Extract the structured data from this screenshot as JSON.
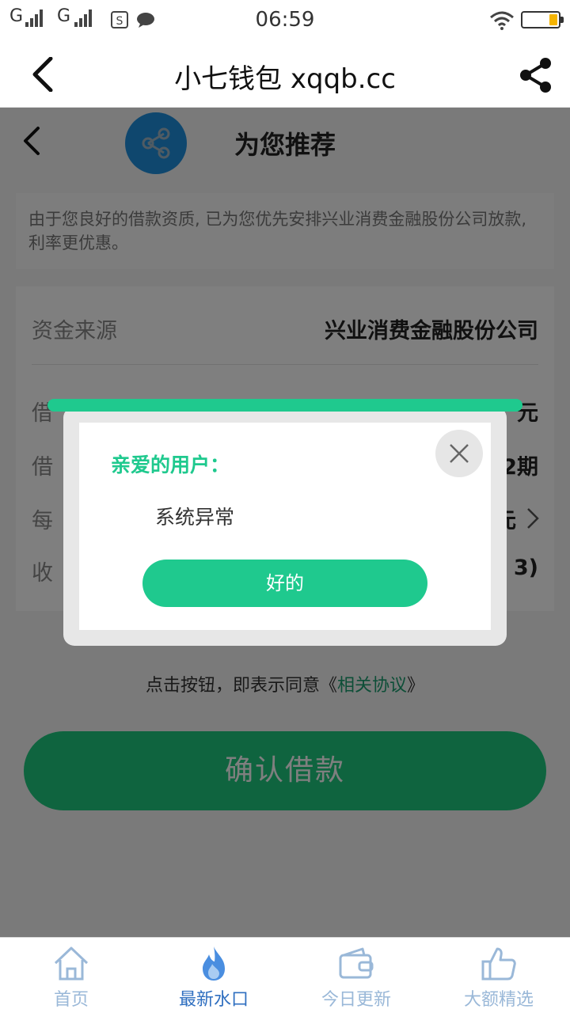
{
  "status_bar": {
    "carrier1": "G",
    "carrier2": "G",
    "time": "06:59",
    "icons": [
      "signal-icon",
      "signal-icon",
      "sim-s-icon",
      "message-icon",
      "wifi-icon",
      "battery-icon"
    ]
  },
  "header": {
    "title": "小七钱包 xqqb.cc"
  },
  "page": {
    "title": "为您推荐",
    "notice": "由于您良好的借款资质, 已为您优先安排兴业消费金融股份公司放款, 利率更优惠。",
    "fund_source_label": "资金来源",
    "fund_source_value": "兴业消费金融股份公司",
    "rows": [
      {
        "label": "借",
        "value": "元"
      },
      {
        "label": "借",
        "value": "2期"
      },
      {
        "label": "每",
        "value": "元"
      },
      {
        "label": "收",
        "value": "3)"
      }
    ],
    "agreement_prefix": "点击按钮，即表示同意《",
    "agreement_link": "相关协议",
    "agreement_suffix": "》",
    "confirm_label": "确认借款"
  },
  "dialog": {
    "title": "亲爱的用户：",
    "message": "系统异常",
    "ok_label": "好的"
  },
  "bottom_nav": [
    {
      "label": "首页",
      "icon": "home-icon"
    },
    {
      "label": "最新水口",
      "icon": "fire-icon"
    },
    {
      "label": "今日更新",
      "icon": "wallet-icon"
    },
    {
      "label": "大额精选",
      "icon": "thumbs-up-icon"
    }
  ],
  "colors": {
    "accent": "#1fc98e",
    "share_blue": "#1e8fdd",
    "nav_active": "#2f6fc0"
  }
}
